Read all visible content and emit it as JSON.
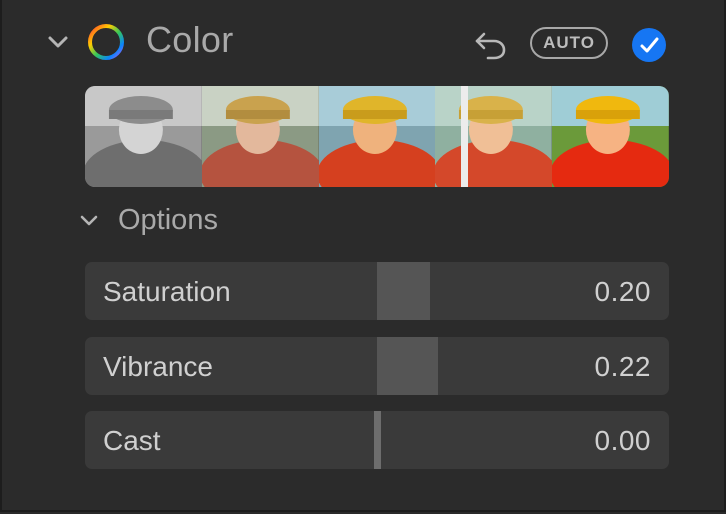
{
  "section": {
    "title": "Color",
    "auto_label": "AUTO",
    "accent": "#1676f3",
    "icons": {
      "collapse": "chevron-down-icon",
      "section": "color-wheel-icon",
      "revert": "undo-icon",
      "enabled": "checkmark-icon"
    }
  },
  "variations": [
    "monochrome",
    "muted-warm",
    "vivid-yellow",
    "warm-split",
    "high-saturation"
  ],
  "options": {
    "label": "Options",
    "sliders": [
      {
        "label": "Saturation",
        "value": "0.20",
        "amount": 0.2
      },
      {
        "label": "Vibrance",
        "value": "0.22",
        "amount": 0.22
      },
      {
        "label": "Cast",
        "value": "0.00",
        "amount": 0.0
      }
    ]
  }
}
